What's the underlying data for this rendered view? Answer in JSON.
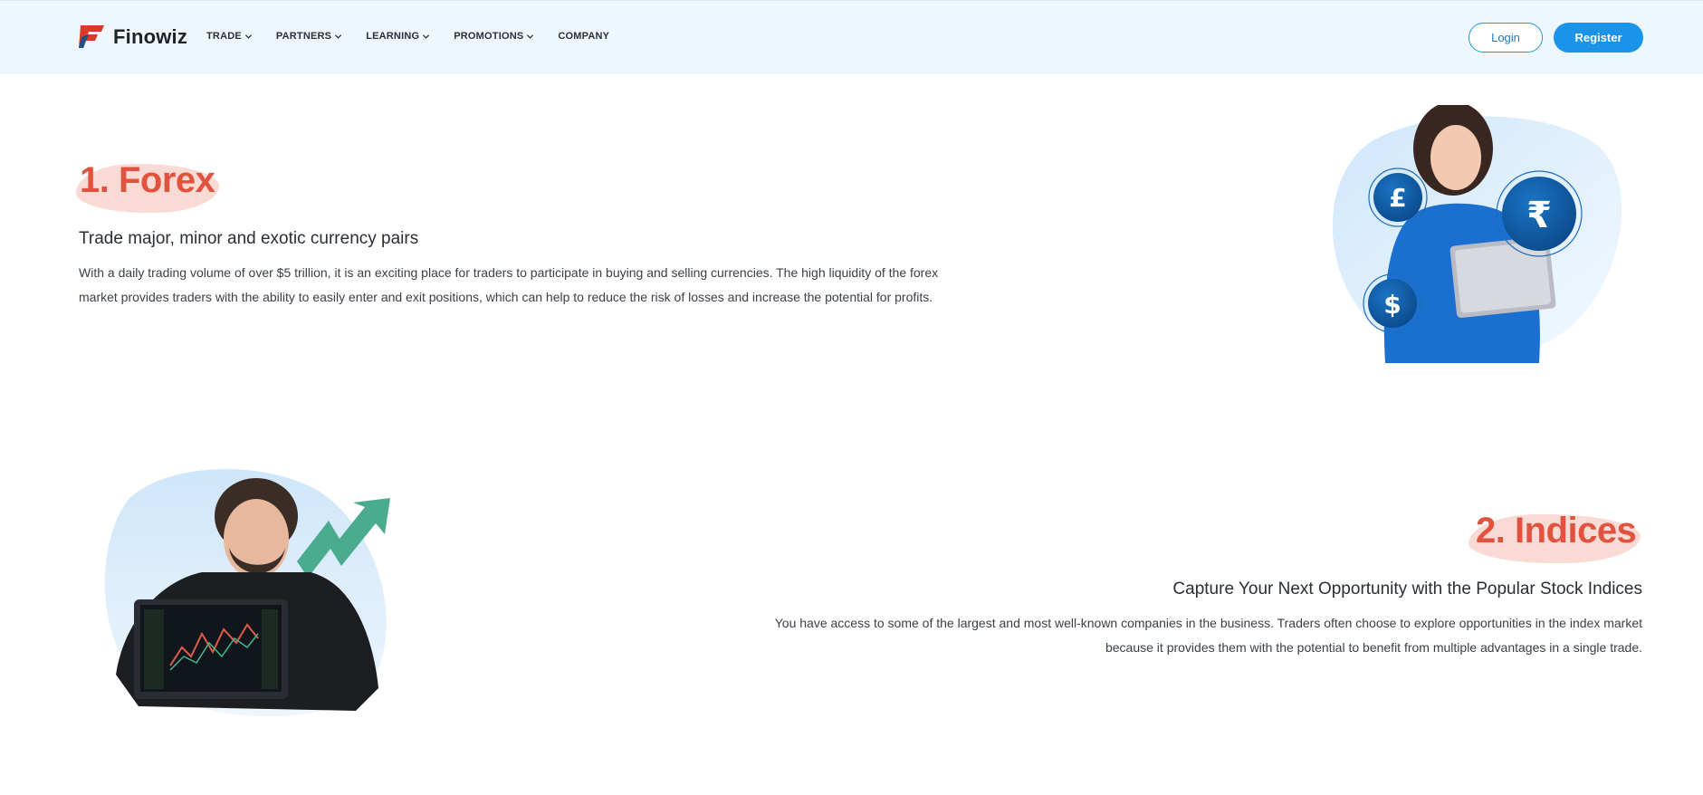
{
  "header": {
    "brand": "Finowiz",
    "nav": [
      {
        "label": "TRADE",
        "has_dropdown": true
      },
      {
        "label": "PARTNERS",
        "has_dropdown": true
      },
      {
        "label": "LEARNING",
        "has_dropdown": true
      },
      {
        "label": "PROMOTIONS",
        "has_dropdown": true
      },
      {
        "label": "COMPANY",
        "has_dropdown": false
      }
    ],
    "login_label": "Login",
    "register_label": "Register"
  },
  "sections": {
    "forex": {
      "title": "1. Forex",
      "subtitle": "Trade major, minor and exotic currency pairs",
      "description_line1": "With a daily trading volume of over $5 trillion, it is an exciting place for traders to participate in buying and selling currencies. The high liquidity of the forex",
      "description_line2": "market provides traders with the ability to easily enter and exit positions, which can help to reduce the risk of losses and increase the potential for profits.",
      "coins": [
        "£",
        "₹",
        "$"
      ]
    },
    "indices": {
      "title": "2. Indices",
      "subtitle": "Capture Your Next Opportunity with the Popular Stock Indices",
      "description_line1": "You have access to some of the largest and most well-known companies in the business. Traders often choose to explore opportunities in the index market",
      "description_line2": "because it provides them with the potential to benefit from multiple advantages in a single trade."
    }
  },
  "colors": {
    "accent_blue": "#1a93e8",
    "title_red": "#e1533f",
    "header_bg": "#eef7fd",
    "highlight_pink": "#f9d3cc",
    "arrow_green": "#4aab8f"
  },
  "icons": [
    "logo-mark",
    "chevron-down-icon",
    "pound-coin-icon",
    "rupee-coin-icon",
    "dollar-coin-icon",
    "trend-arrow-icon"
  ]
}
